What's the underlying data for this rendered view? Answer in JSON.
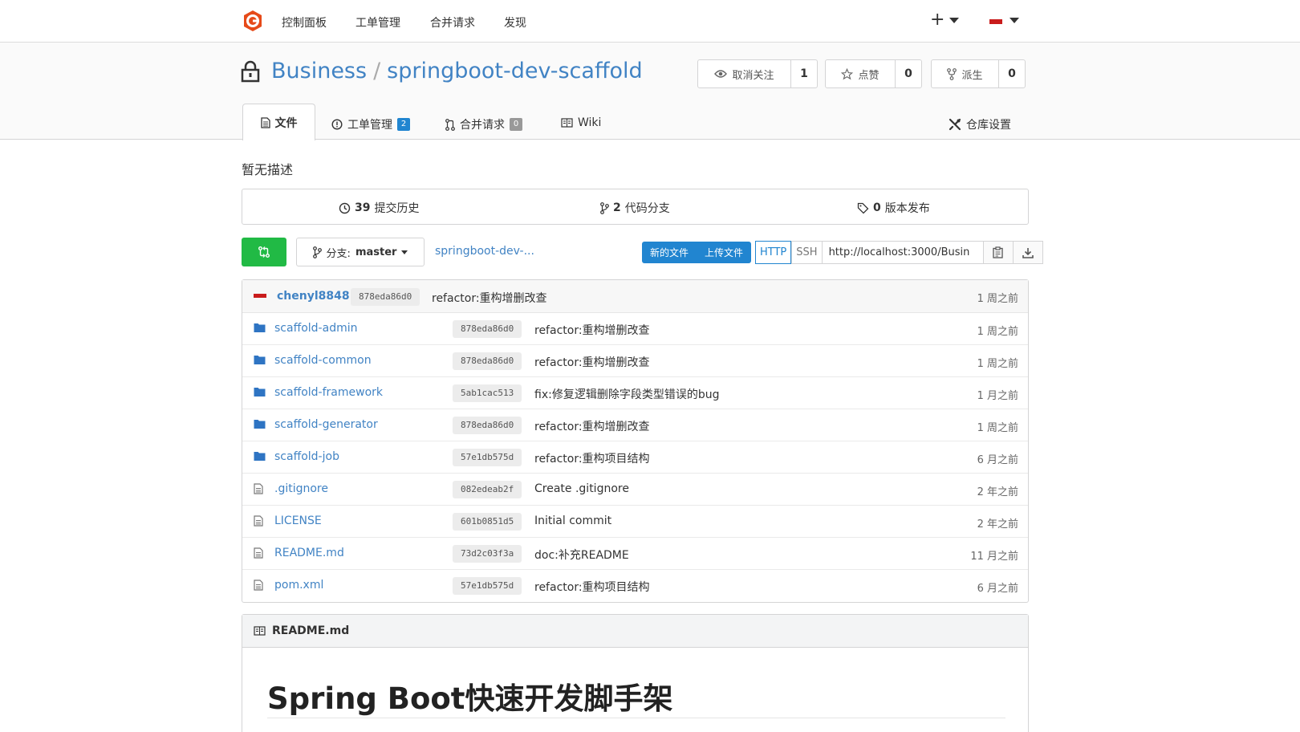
{
  "nav": {
    "items": [
      "控制面板",
      "工单管理",
      "合并请求",
      "发现"
    ],
    "plus": "+"
  },
  "repo": {
    "owner": "Business",
    "separator": "/",
    "name": "springboot-dev-scaffold",
    "watch": {
      "label": "取消关注",
      "count": "1"
    },
    "star": {
      "label": "点赞",
      "count": "0"
    },
    "fork": {
      "label": "派生",
      "count": "0"
    }
  },
  "tabs": {
    "files": "文件",
    "issues": {
      "label": "工单管理",
      "count": "2"
    },
    "pulls": {
      "label": "合并请求",
      "count": "0"
    },
    "wiki": "Wiki",
    "settings": "仓库设置"
  },
  "description": "暂无描述",
  "stats": {
    "commits": {
      "count": "39",
      "label": "提交历史"
    },
    "branches": {
      "count": "2",
      "label": "代码分支"
    },
    "releases": {
      "count": "0",
      "label": "版本发布"
    }
  },
  "toolbar": {
    "branch_label": "分支:",
    "branch_value": "master",
    "path_link": "springboot-dev-...",
    "new_file": "新的文件",
    "upload_file": "上传文件",
    "http": "HTTP",
    "ssh": "SSH",
    "clone_url": "http://localhost:3000/Busin"
  },
  "latest_commit": {
    "author": "chenyl8848",
    "sha": "878eda86d0",
    "message": "refactor:重构增删改查",
    "time": "1 周之前"
  },
  "files": [
    {
      "type": "folder",
      "name": "scaffold-admin",
      "sha": "878eda86d0",
      "message": "refactor:重构增删改查",
      "time": "1 周之前"
    },
    {
      "type": "folder",
      "name": "scaffold-common",
      "sha": "878eda86d0",
      "message": "refactor:重构增删改查",
      "time": "1 周之前"
    },
    {
      "type": "folder",
      "name": "scaffold-framework",
      "sha": "5ab1cac513",
      "message": "fix:修复逻辑删除字段类型错误的bug",
      "time": "1 月之前"
    },
    {
      "type": "folder",
      "name": "scaffold-generator",
      "sha": "878eda86d0",
      "message": "refactor:重构增删改查",
      "time": "1 周之前"
    },
    {
      "type": "folder",
      "name": "scaffold-job",
      "sha": "57e1db575d",
      "message": "refactor:重构项目结构",
      "time": "6 月之前"
    },
    {
      "type": "file",
      "name": ".gitignore",
      "sha": "082edeab2f",
      "message": "Create .gitignore",
      "time": "2 年之前"
    },
    {
      "type": "file",
      "name": "LICENSE",
      "sha": "601b0851d5",
      "message": "Initial commit",
      "time": "2 年之前"
    },
    {
      "type": "file",
      "name": "README.md",
      "sha": "73d2c03f3a",
      "message": "doc:补充README",
      "time": "11 月之前"
    },
    {
      "type": "file",
      "name": "pom.xml",
      "sha": "57e1db575d",
      "message": "refactor:重构项目结构",
      "time": "6 月之前"
    }
  ],
  "readme": {
    "filename": "README.md",
    "heading": "Spring Boot快速开发脚手架"
  },
  "colors": {
    "link": "#4183c4",
    "green": "#21ba45",
    "blue": "#2185d0",
    "logo": "#e64a19"
  }
}
